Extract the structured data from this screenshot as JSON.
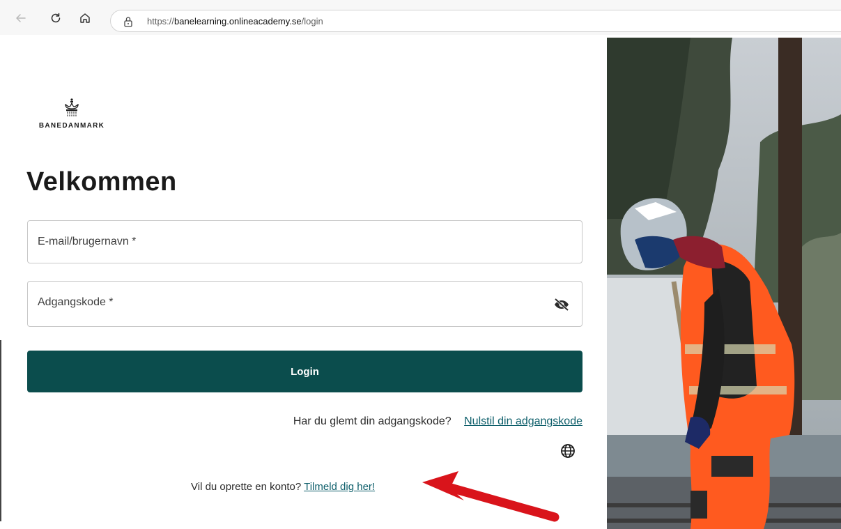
{
  "browser": {
    "url_scheme": "https://",
    "url_domain": "banelearning.onlineacademy.se",
    "url_path": "/login"
  },
  "brand": {
    "name": "BANEDANMARK"
  },
  "login": {
    "heading": "Velkommen",
    "email_label": "E-mail/brugernavn *",
    "password_label": "Adgangskode *",
    "submit_label": "Login",
    "forgot_text": "Har du glemt din adgangskode?",
    "reset_link": "Nulstil din adgangskode",
    "signup_text": "Vil du oprette en konto?",
    "signup_link": "Tilmeld dig her!"
  },
  "colors": {
    "primary": "#0b4d4d",
    "link": "#0e5f6b",
    "annotation_arrow": "#d9141b"
  },
  "icons": [
    "back-arrow-icon",
    "reload-icon",
    "home-icon",
    "lock-icon",
    "eye-slash-icon",
    "globe-icon"
  ]
}
